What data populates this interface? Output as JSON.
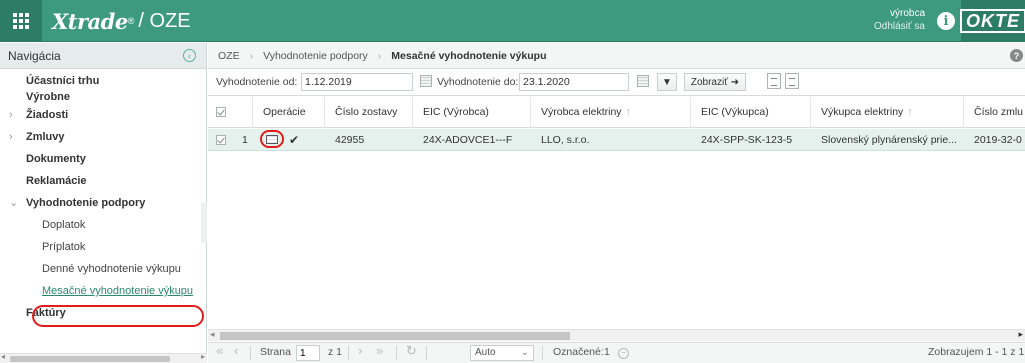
{
  "header": {
    "app_brand": "Xtrade",
    "app_suffix": "/ OZE",
    "user_name": "výrobca",
    "logout_label": "Odhlásiť sa",
    "org_logo": "OKTE"
  },
  "sidebar": {
    "title": "Navigácia",
    "items": [
      {
        "label": "Účastníci trhu",
        "level": 0
      },
      {
        "label": "Výrobne",
        "level": 0
      },
      {
        "label": "Žiadosti",
        "level": 0,
        "chevron": ">"
      },
      {
        "label": "Zmluvy",
        "level": 0,
        "chevron": ">"
      },
      {
        "label": "Dokumenty",
        "level": 0
      },
      {
        "label": "Reklamácie",
        "level": 0
      },
      {
        "label": "Vyhodnotenie podpory",
        "level": 0,
        "chevron": "v"
      },
      {
        "label": "Doplatok",
        "level": 1
      },
      {
        "label": "Príplatok",
        "level": 1
      },
      {
        "label": "Denné vyhodnotenie výkupu",
        "level": 1
      },
      {
        "label": "Mesačné vyhodnotenie výkupu",
        "level": 1,
        "active": true
      },
      {
        "label": "Faktúry",
        "level": 0
      }
    ]
  },
  "breadcrumb": {
    "items": [
      "OZE",
      "Vyhodnotenie podpory",
      "Mesačné vyhodnotenie výkupu"
    ]
  },
  "filter": {
    "from_label": "Vyhodnotenie od:",
    "from_value": "1.12.2019",
    "to_label": "Vyhodnotenie do:",
    "to_value": "23.1.2020",
    "show_label": "Zobraziť"
  },
  "grid": {
    "columns": [
      "Operácie",
      "Číslo zostavy",
      "EIC (Výrobca)",
      "Výrobca elektriny",
      "EIC (Výkupca)",
      "Výkupca elektriny",
      "Číslo zmlu"
    ],
    "row": {
      "index": "1",
      "report_no": "42955",
      "eic_producer": "24X-ADOVCE1---F",
      "producer": "LLO, s.r.o.",
      "eic_buyer": "24X-SPP-SK-123-5",
      "buyer": "Slovenský plynárenský prie...",
      "contract_no": "2019-32-0"
    }
  },
  "pager": {
    "page_label": "Strana",
    "page_value": "1",
    "of_label": "z 1",
    "page_size": "Auto",
    "marked_label": "Označené:",
    "marked_count": "1",
    "showing_label": "Zobrazujem 1 - 1 z 1"
  },
  "colors": {
    "header_bg": "#3e9a7f",
    "row_selected": "#e4f1ec",
    "highlight": "#e01d1d"
  }
}
